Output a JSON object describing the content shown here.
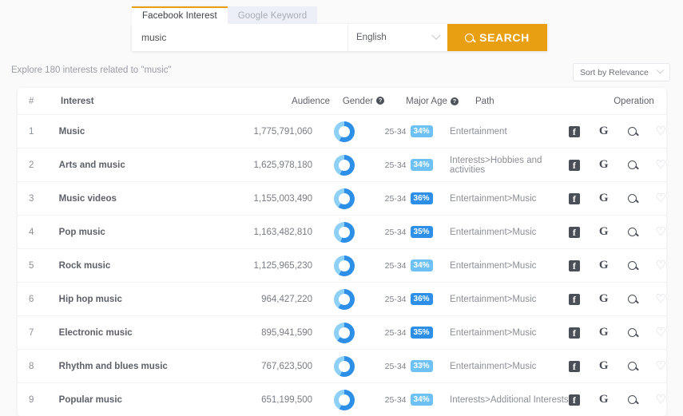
{
  "search": {
    "tabs": [
      {
        "label": "Facebook Interest",
        "active": true
      },
      {
        "label": "Google Keyword",
        "active": false
      }
    ],
    "keyword_value": "music",
    "keyword_placeholder": "music",
    "language": "English",
    "search_button": "SEARCH"
  },
  "results": {
    "summary": "Explore 180 interests related to \"music\"",
    "sort_label": "Sort by Relevance"
  },
  "table": {
    "headers": {
      "num": "#",
      "interest": "Interest",
      "audience": "Audience",
      "gender": "Gender",
      "major_age": "Major Age",
      "path": "Path",
      "operation": "Operation"
    },
    "help_glyph": "?",
    "rows": [
      {
        "num": "1",
        "interest": "Music",
        "audience": "1,775,791,060",
        "gender_male_pct": 58,
        "age": "25-34",
        "pct": "34%",
        "pct_tone": "light",
        "path": "Entertainment"
      },
      {
        "num": "2",
        "interest": "Arts and music",
        "audience": "1,625,978,180",
        "gender_male_pct": 57,
        "age": "25-34",
        "pct": "34%",
        "pct_tone": "light",
        "path": "Interests>Hobbies and activities"
      },
      {
        "num": "3",
        "interest": "Music videos",
        "audience": "1,155,003,490",
        "gender_male_pct": 60,
        "age": "25-34",
        "pct": "36%",
        "pct_tone": "dark",
        "path": "Entertainment>Music"
      },
      {
        "num": "4",
        "interest": "Pop music",
        "audience": "1,163,482,810",
        "gender_male_pct": 56,
        "age": "25-34",
        "pct": "35%",
        "pct_tone": "dark",
        "path": "Entertainment>Music"
      },
      {
        "num": "5",
        "interest": "Rock music",
        "audience": "1,125,965,230",
        "gender_male_pct": 59,
        "age": "25-34",
        "pct": "34%",
        "pct_tone": "light",
        "path": "Entertainment>Music"
      },
      {
        "num": "6",
        "interest": "Hip hop music",
        "audience": "964,427,220",
        "gender_male_pct": 60,
        "age": "25-34",
        "pct": "36%",
        "pct_tone": "dark",
        "path": "Entertainment>Music"
      },
      {
        "num": "7",
        "interest": "Electronic music",
        "audience": "895,941,590",
        "gender_male_pct": 62,
        "age": "25-34",
        "pct": "35%",
        "pct_tone": "dark",
        "path": "Entertainment>Music"
      },
      {
        "num": "8",
        "interest": "Rhythm and blues music",
        "audience": "767,623,500",
        "gender_male_pct": 57,
        "age": "25-34",
        "pct": "33%",
        "pct_tone": "light",
        "path": "Entertainment>Music"
      },
      {
        "num": "9",
        "interest": "Popular music",
        "audience": "651,199,500",
        "gender_male_pct": 58,
        "age": "25-34",
        "pct": "34%",
        "pct_tone": "light",
        "path": "Interests>Additional Interests"
      }
    ],
    "operations": [
      {
        "name": "facebook-icon",
        "glyph": "f"
      },
      {
        "name": "google-icon",
        "glyph": "G"
      },
      {
        "name": "search-icon",
        "glyph": ""
      },
      {
        "name": "favorite-icon",
        "glyph": "♡"
      }
    ]
  },
  "colors": {
    "accent_orange": "#e8a012",
    "donut_dark": "#2d8fe8",
    "donut_light": "#8fd0f7",
    "badge_light": "#6ec1f5",
    "badge_dark": "#2d8fe8"
  }
}
